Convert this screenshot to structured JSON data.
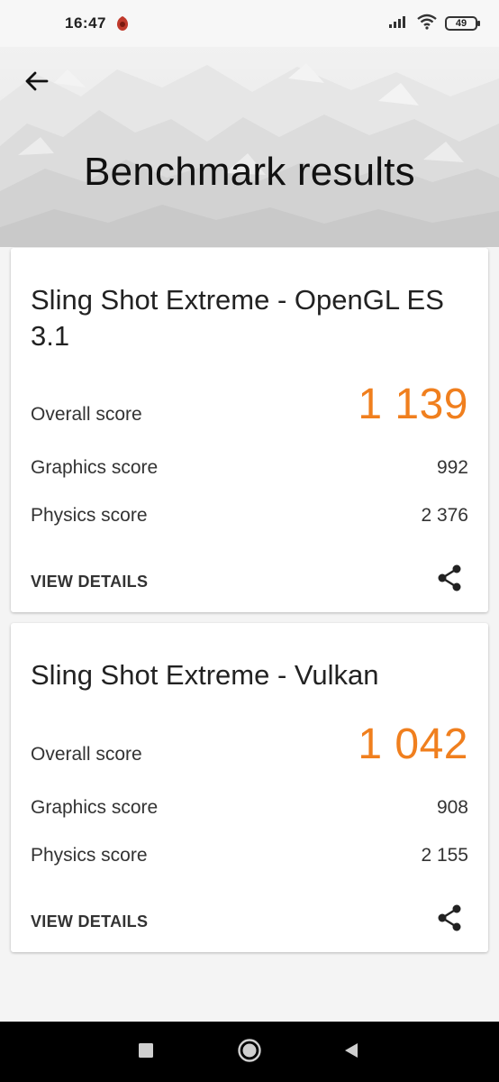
{
  "status_bar": {
    "time": "16:47",
    "battery": "49"
  },
  "header": {
    "title": "Benchmark results"
  },
  "results": [
    {
      "title": "Sling Shot Extreme - OpenGL ES 3.1",
      "overall_label": "Overall score",
      "overall_value": "1 139",
      "graphics_label": "Graphics score",
      "graphics_value": "992",
      "physics_label": "Physics score",
      "physics_value": "2 376",
      "details_label": "VIEW DETAILS"
    },
    {
      "title": "Sling Shot Extreme - Vulkan",
      "overall_label": "Overall score",
      "overall_value": "1 042",
      "graphics_label": "Graphics score",
      "graphics_value": "908",
      "physics_label": "Physics score",
      "physics_value": "2 155",
      "details_label": "VIEW DETAILS"
    }
  ],
  "icons": {
    "back": "arrow-left-icon",
    "share": "share-icon",
    "nav_recents": "square-icon",
    "nav_home": "circle-icon",
    "nav_back": "triangle-back-icon"
  },
  "colors": {
    "accent": "#f07f1e",
    "background": "#f4f4f4",
    "card": "#ffffff",
    "navbar": "#000000"
  }
}
